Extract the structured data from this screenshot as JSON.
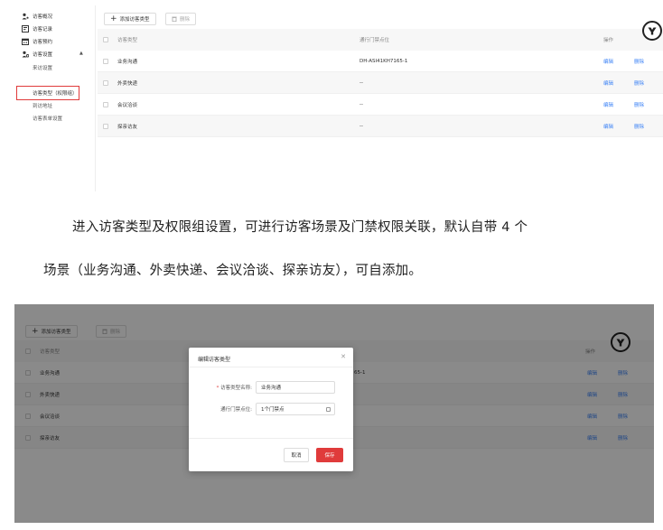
{
  "sidebar": {
    "items": [
      {
        "label": "访客概况",
        "icon": "user-star-icon"
      },
      {
        "label": "访客记录",
        "icon": "record-icon"
      },
      {
        "label": "访客预约",
        "icon": "calendar-icon"
      },
      {
        "label": "访客设置",
        "icon": "user-gear-icon"
      }
    ],
    "sub_items": [
      "来访设置",
      "访客类型（权限组）",
      "到访地址",
      "访客表单设置"
    ]
  },
  "toolbar": {
    "add_label": "添加访客类型",
    "delete_label": "删除"
  },
  "table": {
    "headers": {
      "type": "访客类型",
      "door": "通行门禁点位",
      "ops": "操作"
    },
    "rows": [
      {
        "type": "业务沟通",
        "door": "DH-ASI41KH7165-1"
      },
      {
        "type": "外卖快递",
        "door": "--"
      },
      {
        "type": "会议洽谈",
        "door": "--"
      },
      {
        "type": "探亲访友",
        "door": "--"
      }
    ],
    "edit_label": "编辑",
    "delete_label": "删除",
    "door_partial": "65-1"
  },
  "caption": {
    "line1": "进入访客类型及权限组设置，可进行访客场景及门禁权限关联，默认自带 4 个",
    "line2": "场景（业务沟通、外卖快递、会议洽谈、探亲访友），可自添加。"
  },
  "modal": {
    "title": "编辑访客类型",
    "name_label": "访客类型名称:",
    "name_value": "业务沟通",
    "door_label": "通行门禁点位:",
    "door_value": "1个门禁点",
    "cancel_label": "取消",
    "save_label": "保存"
  },
  "colors": {
    "accent": "#e03b3b",
    "link": "#3b82f6"
  }
}
